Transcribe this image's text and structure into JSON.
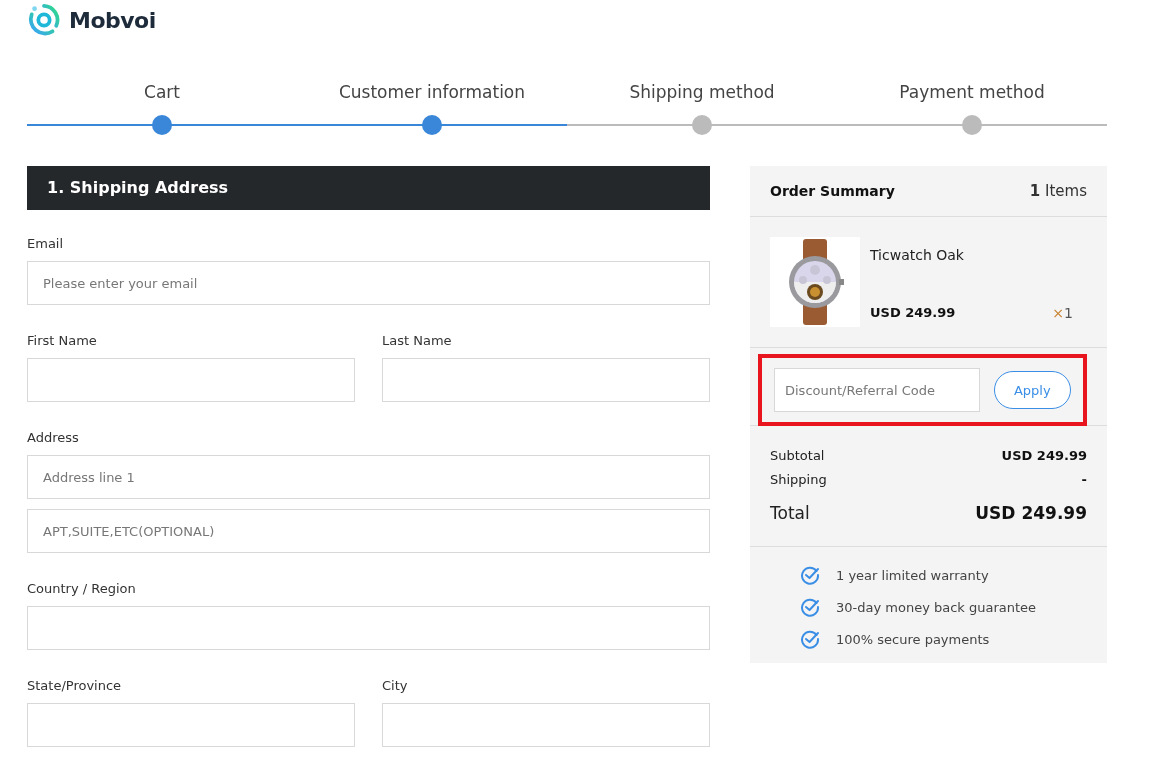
{
  "brand": {
    "name": "Mobvoi"
  },
  "steps": [
    {
      "label": "Cart",
      "done": true
    },
    {
      "label": "Customer information",
      "done": true
    },
    {
      "label": "Shipping method",
      "done": false
    },
    {
      "label": "Payment method",
      "done": false
    }
  ],
  "form": {
    "title": "1. Shipping Address",
    "rows": [
      {
        "fields": [
          {
            "label": "Email",
            "placeholders": [
              "Please enter your email"
            ]
          }
        ]
      },
      {
        "fields": [
          {
            "label": "First Name"
          },
          {
            "label": "Last Name"
          }
        ]
      },
      {
        "fields": [
          {
            "label": "Address",
            "placeholders": [
              "Address line 1",
              "APT,SUITE,ETC(OPTIONAL)"
            ]
          }
        ]
      },
      {
        "fields": [
          {
            "label": "Country / Region"
          }
        ]
      },
      {
        "fields": [
          {
            "label": "State/Province"
          },
          {
            "label": "City"
          }
        ]
      }
    ]
  },
  "summary": {
    "title": "Order Summary",
    "count": "**1** Items",
    "items": [
      {
        "name": "Ticwatch Oak",
        "price": "USD 249.99",
        "quantity": "×1"
      }
    ],
    "discount": {
      "placeholder": "Discount/Referral Code",
      "button": "Apply",
      "highlighted": true
    },
    "subtotal": {
      "label": "Subtotal",
      "value": "USD 249.99"
    },
    "shipping": {
      "label": "Shipping",
      "value": "-"
    },
    "total": {
      "label": "Total",
      "value": "USD 249.99"
    },
    "perks": [
      "1 year limited warranty",
      "30-day money back guarantee",
      "100% secure payments"
    ]
  }
}
